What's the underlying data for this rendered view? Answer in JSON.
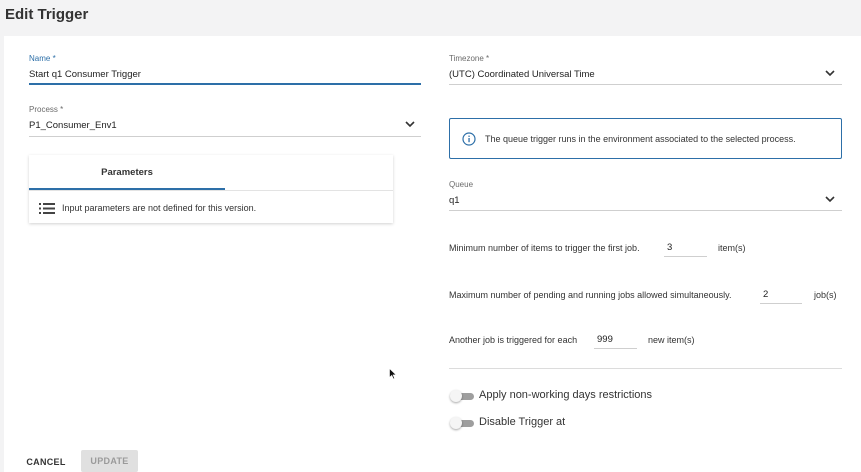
{
  "header": {
    "title": "Edit Trigger"
  },
  "form": {
    "name": {
      "label": "Name *",
      "value": "Start q1 Consumer Trigger"
    },
    "process": {
      "label": "Process *",
      "value": "P1_Consumer_Env1"
    },
    "parameters": {
      "tab_label": "Parameters",
      "message": "Input parameters are not defined for this version."
    },
    "timezone": {
      "label": "Timezone *",
      "value": "(UTC) Coordinated Universal Time"
    },
    "info_message": "The queue trigger runs in the environment associated to the selected process.",
    "queue": {
      "label": "Queue",
      "value": "q1"
    },
    "min_items": {
      "prefix": "Minimum number of items to trigger the first job.",
      "value": "3",
      "suffix": "item(s)"
    },
    "max_jobs": {
      "prefix": "Maximum number of pending and running jobs allowed simultaneously.",
      "value": "2",
      "suffix": "job(s)"
    },
    "another_job": {
      "prefix": "Another job is triggered for each",
      "value": "999",
      "suffix": "new item(s)"
    },
    "toggles": {
      "non_working_days": {
        "label": "Apply non-working days restrictions",
        "on": false
      },
      "disable_trigger": {
        "label": "Disable Trigger at",
        "on": false
      }
    }
  },
  "footer": {
    "cancel_label": "CANCEL",
    "update_label": "UPDATE"
  },
  "colors": {
    "accent": "#2d6fa8",
    "toggle_off": "#9e9e9e",
    "disabled_bg": "#e0e0e0"
  },
  "icons": {
    "list": "list-icon",
    "info": "info-icon",
    "chevron": "chevron-down-icon"
  }
}
